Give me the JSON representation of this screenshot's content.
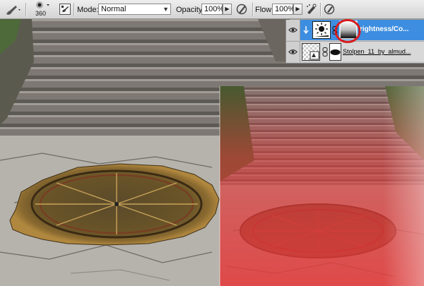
{
  "options_bar": {
    "brush_size": "360",
    "mode_label": "Mode:",
    "mode_value": "Normal",
    "opacity_label": "Opacity:",
    "opacity_value": "100%",
    "flow_label": "Flow:",
    "flow_value": "100%"
  },
  "layers": [
    {
      "name": "rightness/Co...",
      "selected": true,
      "type": "adjustment-brightness-contrast"
    },
    {
      "name": "Stolpen_11_by_almud...",
      "selected": false,
      "type": "image"
    }
  ],
  "colors": {
    "selection_blue": "#3d8ee0",
    "mask_overlay_red": "#e83a3a",
    "annotation_circle": "#d71c1c"
  }
}
